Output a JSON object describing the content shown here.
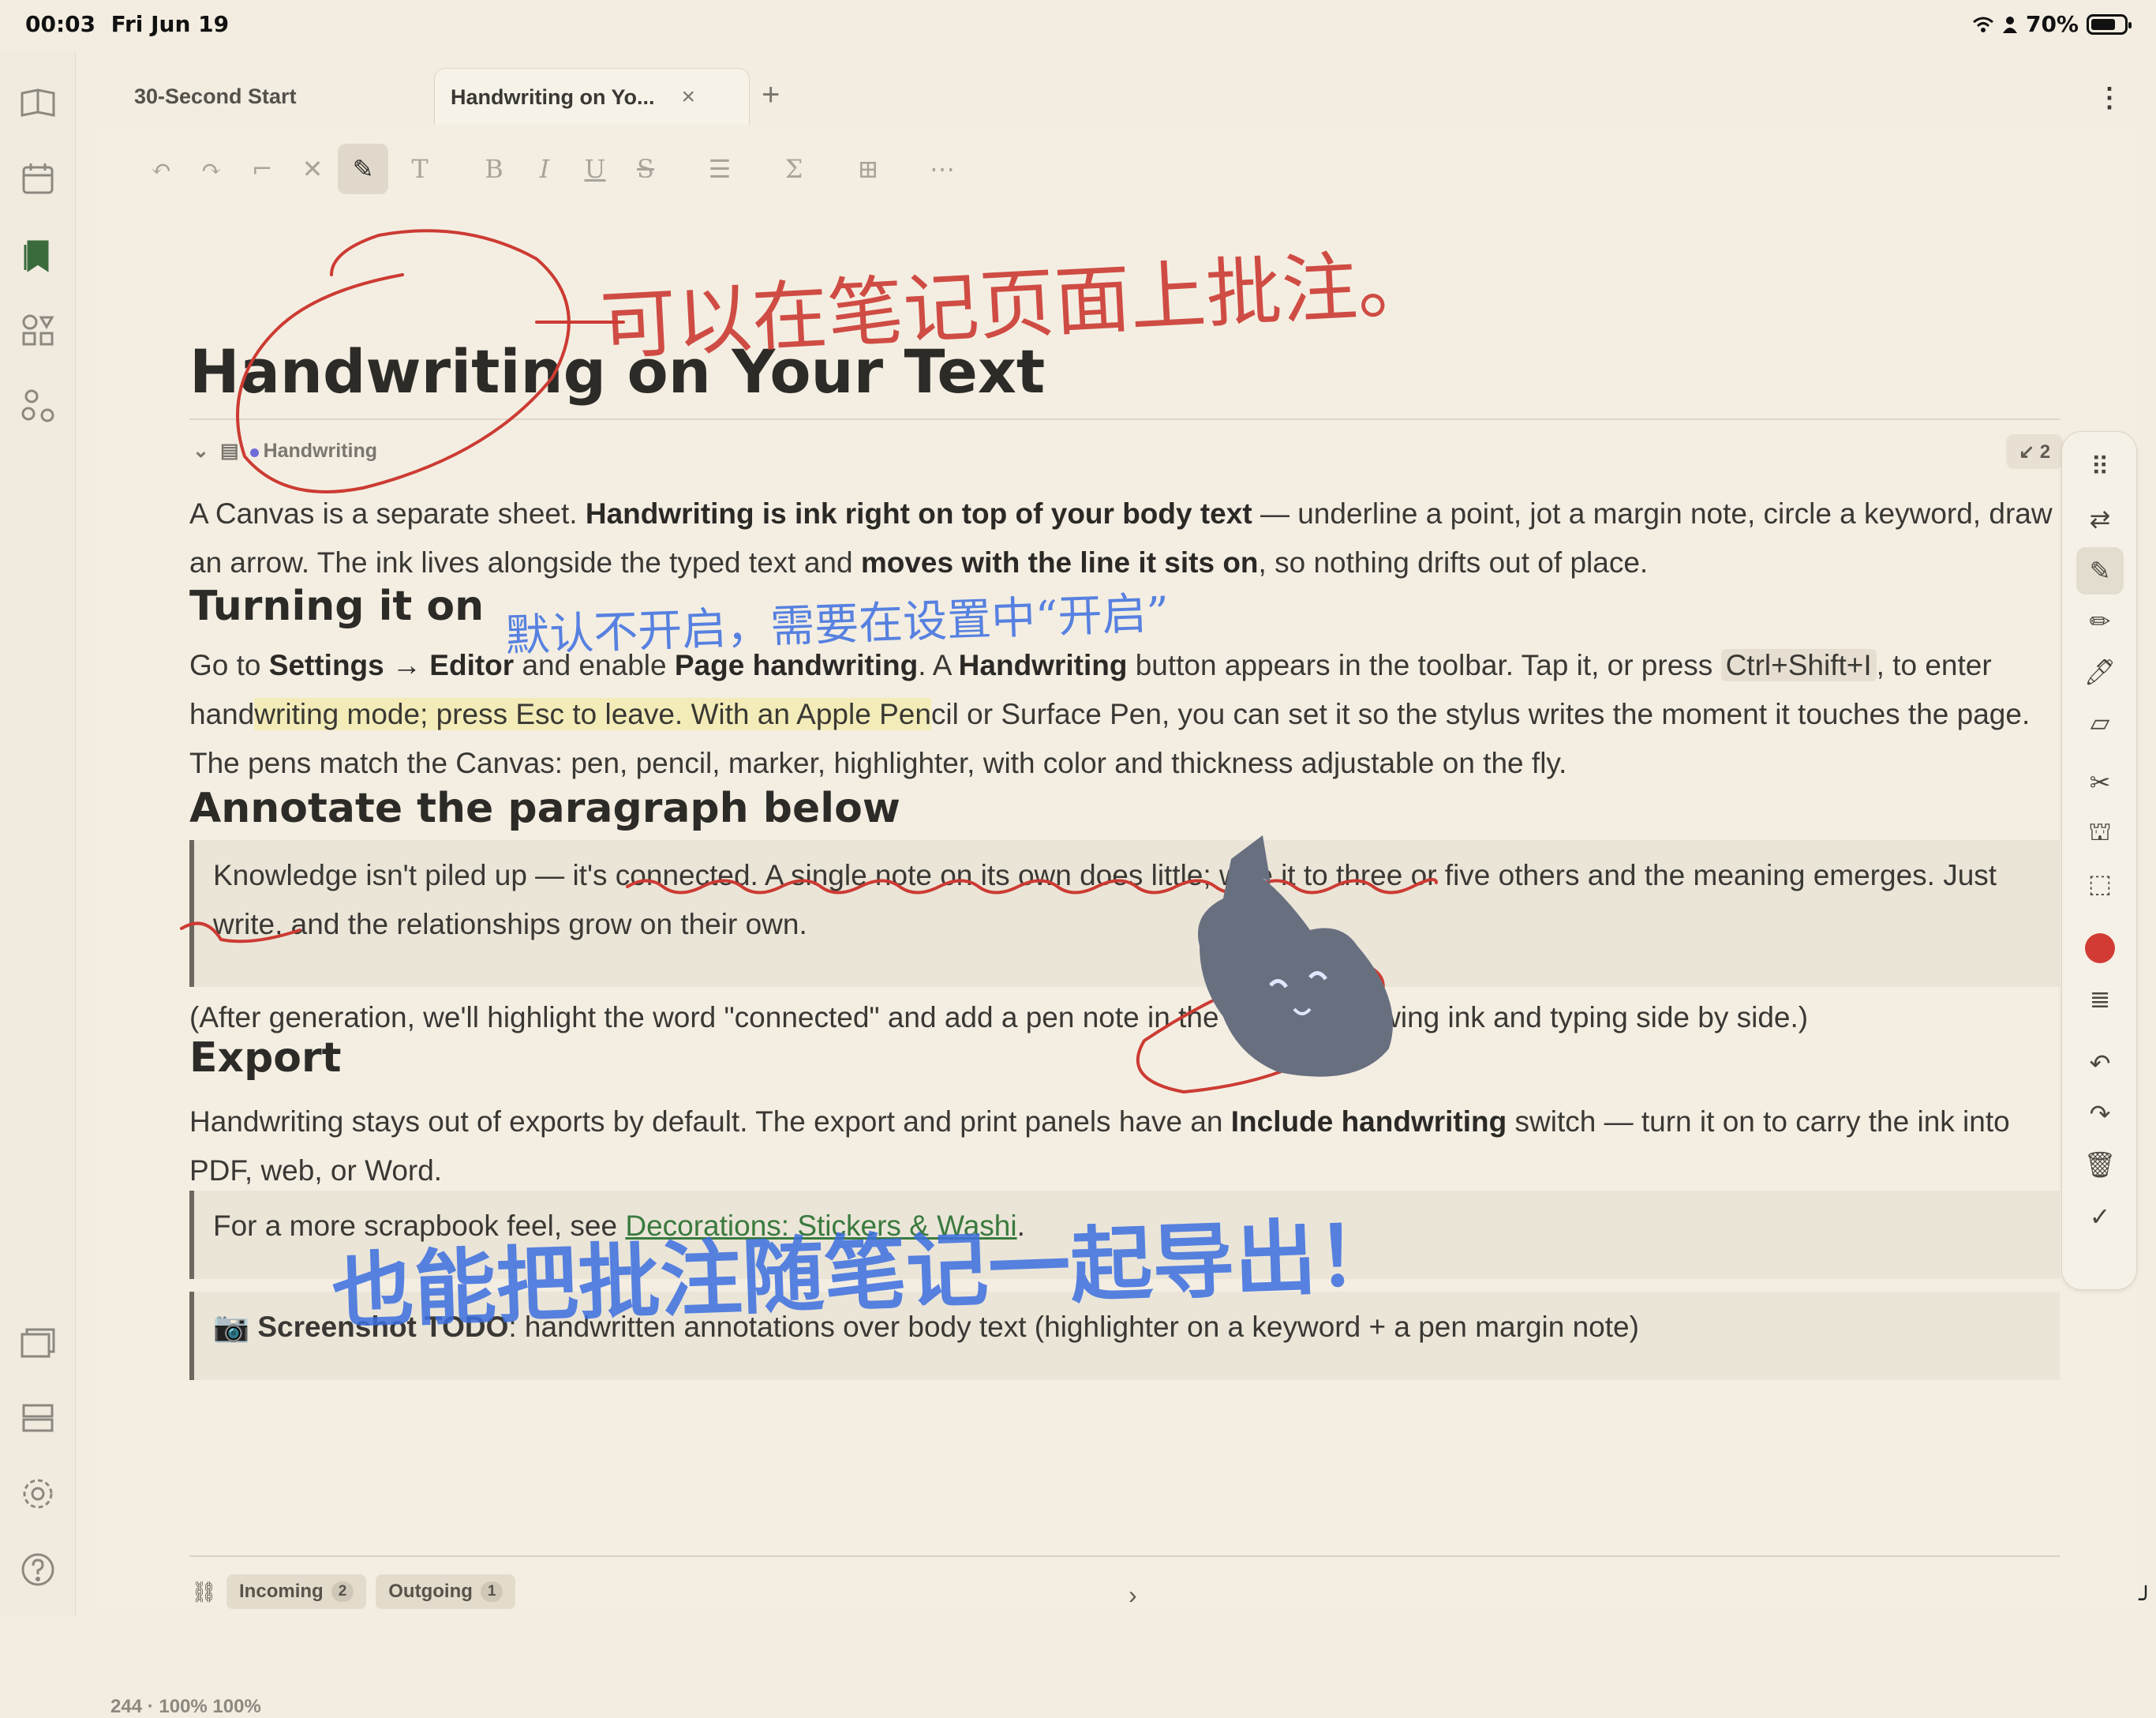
{
  "status": {
    "time": "00:03",
    "date": "Fri Jun 19",
    "battery": "70%"
  },
  "tabs": [
    {
      "label": "30-Second Start",
      "close": ""
    },
    {
      "label": "Handwriting on Yo...",
      "close": "×"
    }
  ],
  "tab_add": "+",
  "menu_dots": "⋮",
  "toolbar": {
    "undo": "↶",
    "redo": "↷",
    "format_painter": "⌐",
    "clear_format": "✕",
    "handwriting": "✎",
    "heading": "T",
    "bold": "B",
    "italic": "I",
    "underline": "U",
    "strike": "S",
    "list": "☰",
    "sum": "Σ",
    "insert": "⊞",
    "more": "⋯"
  },
  "doc": {
    "title": "Handwriting on Your Text",
    "tag": "Handwriting",
    "backlinks": "↙ 2",
    "p1_a": "A Canvas is a separate sheet. ",
    "p1_b": "Handwriting is ink right on top of your body text",
    "p1_c": " — underline a point, jot a margin note, circle a keyword, draw an arrow. The ink lives alongside the typed text and ",
    "p1_d": "moves with the line it sits on",
    "p1_e": ", so nothing drifts out of place.",
    "h_turning": "Turning it on",
    "p2_a": "Go to ",
    "p2_b": "Settings → Editor",
    "p2_c": " and enable ",
    "p2_d": "Page handwriting",
    "p2_e": ". A ",
    "p2_f": "Handwriting",
    "p2_g": " button appears in the toolbar. Tap it, or press ",
    "p2_kbd": "Ctrl+Shift+I",
    "p2_h": ", to enter hand",
    "p2_hl": "writing mode; press Esc to leave. With an Apple Pen",
    "p2_i": "cil or Surface Pen, you can set it so the stylus writes the moment it touches the page. The pens match the Canvas: pen, pencil, marker, highlighter, with color and thickness adjustable on the fly.",
    "h_annotate": "Annotate the paragraph below",
    "quote1": "Knowledge isn't piled up — it's connected. A single note on its own does little; wire it to three or five others and the meaning emerges. Just write, and the relationships grow on their own.",
    "p3": "(After generation, we'll highlight the word \"connected\" and add a pen note in the margin, showing ink and typing side by side.)",
    "h_export": "Export",
    "p4_a": "Handwriting stays out of exports by default. The export and print panels have an ",
    "p4_b": "Include handwriting",
    "p4_c": " switch — turn it on to carry the ink into PDF, web, or Word.",
    "quote2_a": "For a more scrapbook feel, see ",
    "quote2_link": "Decorations: Stickers & Washi",
    "quote2_b": ".",
    "quote3_icon": "📷",
    "quote3_bold": "Screenshot TODO",
    "quote3_rest": ": handwritten annotations over body text (highlighter on a keyword + a pen margin note)"
  },
  "footer": {
    "incoming_label": "Incoming",
    "incoming_count": "2",
    "outgoing_label": "Outgoing",
    "outgoing_count": "1",
    "chevron": "›"
  },
  "bottom_status": "244 · 100%     100%",
  "handwriting_notes": {
    "note_top": "可以在笔记页面上批注。",
    "note_mid": "默认不开启，需要在设置中“开启”",
    "note_bottom": "也能把批注随笔记一起导出！"
  },
  "colors": {
    "accent": "#3a6b3d",
    "ink_red": "#cc3b33",
    "ink_blue": "#3c6fe0",
    "highlight": "#f3ecb8"
  }
}
